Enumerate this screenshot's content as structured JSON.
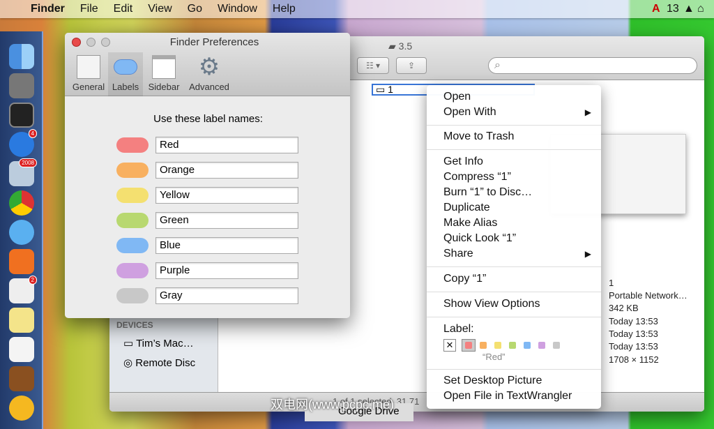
{
  "menubar": {
    "app": "Finder",
    "items": [
      "File",
      "Edit",
      "View",
      "Go",
      "Window",
      "Help"
    ],
    "status_count": "13"
  },
  "finder": {
    "title": "3.5",
    "search_placeholder": "",
    "file_name": "1",
    "sidebar_header": "DEVICES",
    "devices": [
      "Tim’s Mac…",
      "Remote Disc"
    ],
    "status": "1 of 1 selected, 31.71",
    "partial_item": "Google Drive",
    "info_values": [
      "1",
      "Portable Network…",
      "342 KB",
      "Today 13:53",
      "Today 13:53",
      "Today 13:53",
      "1708 × 1152"
    ]
  },
  "prefs": {
    "title": "Finder Preferences",
    "tabs": [
      "General",
      "Labels",
      "Sidebar",
      "Advanced"
    ],
    "heading": "Use these label names:",
    "labels": [
      {
        "name": "Red",
        "color": "#f48080"
      },
      {
        "name": "Orange",
        "color": "#f8b060"
      },
      {
        "name": "Yellow",
        "color": "#f4e070"
      },
      {
        "name": "Green",
        "color": "#b8d870"
      },
      {
        "name": "Blue",
        "color": "#80b8f4"
      },
      {
        "name": "Purple",
        "color": "#cfa0e0"
      },
      {
        "name": "Gray",
        "color": "#c8c8c8"
      }
    ]
  },
  "context_menu": {
    "items": [
      "Open",
      "Open With",
      "Move to Trash",
      "Get Info",
      "Compress “1”",
      "Burn “1” to Disc…",
      "Duplicate",
      "Make Alias",
      "Quick Look “1”",
      "Share",
      "Copy “1”",
      "Show View Options",
      "Label:",
      "Set Desktop Picture",
      "Open File in TextWrangler"
    ],
    "selected_label": "“Red”"
  },
  "watermark": "双电网(www.pcpc.me)"
}
